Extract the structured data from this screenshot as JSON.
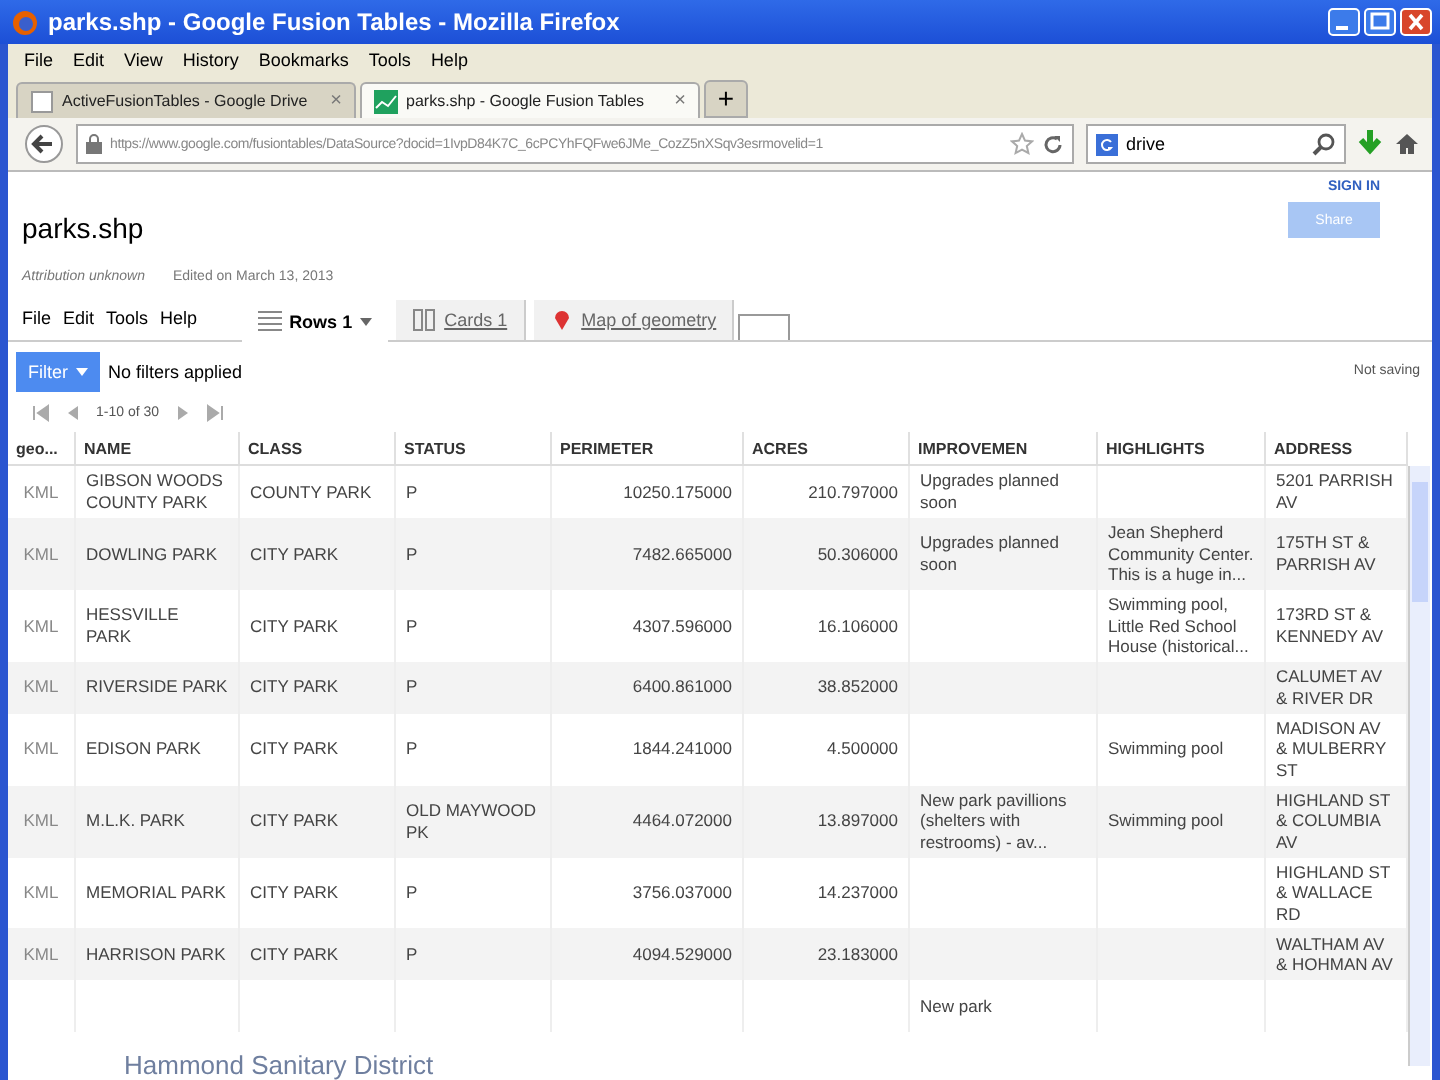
{
  "window": {
    "title": "parks.shp - Google Fusion Tables - Mozilla Firefox"
  },
  "menu": [
    "File",
    "Edit",
    "View",
    "History",
    "Bookmarks",
    "Tools",
    "Help"
  ],
  "browser_tabs": [
    {
      "label": "ActiveFusionTables - Google Drive",
      "selected": false,
      "close": "×"
    },
    {
      "label": "parks.shp - Google Fusion Tables",
      "selected": true,
      "close": "×"
    }
  ],
  "new_tab": "+",
  "address_bar": {
    "value": "https://www.google.com/fusiontables/DataSource?docid=1IvpD84K7C_6cPCYhFQFwe6JMe_CozZ5nXSqv3esrmovelid=1"
  },
  "search_field": {
    "value": "drive"
  },
  "page": {
    "title": "parks.shp",
    "sign_in": "SIGN IN",
    "share": "Share",
    "attribution": "Attribution unknown",
    "edited": "Edited on March 13, 2013"
  },
  "app_menu": [
    "File",
    "Edit",
    "Tools",
    "Help"
  ],
  "view_tabs": [
    {
      "label": "Rows 1",
      "kind": "rows",
      "selected": true
    },
    {
      "label": "Cards 1",
      "kind": "cards",
      "selected": false
    },
    {
      "label": "Map of geometry",
      "kind": "map",
      "selected": false
    }
  ],
  "filter": {
    "button": "Filter",
    "text": "No filters applied",
    "status": "Not saving"
  },
  "pager": "1-10 of 30",
  "table": {
    "columns": [
      "geo...",
      "NAME",
      "CLASS",
      "STATUS",
      "PERIMETER",
      "ACRES",
      "IMPROVEMEN",
      "HIGHLIGHTS",
      "ADDRESS"
    ],
    "rows": [
      [
        "KML",
        "GIBSON WOODS COUNTY PARK",
        "COUNTY PARK",
        "P",
        "10250.175000",
        "210.797000",
        "Upgrades planned soon",
        "",
        "5201 PARRISH AV"
      ],
      [
        "KML",
        "DOWLING PARK",
        "CITY PARK",
        "P",
        "7482.665000",
        "50.306000",
        "Upgrades planned soon",
        "Jean Shepherd Community Center. This is a huge in...",
        "175TH ST & PARRISH AV"
      ],
      [
        "KML",
        "HESSVILLE PARK",
        "CITY PARK",
        "P",
        "4307.596000",
        "16.106000",
        "",
        "Swimming pool, Little Red School House (historical...",
        "173RD ST & KENNEDY AV"
      ],
      [
        "KML",
        "RIVERSIDE PARK",
        "CITY PARK",
        "P",
        "6400.861000",
        "38.852000",
        "",
        "",
        "CALUMET AV & RIVER DR"
      ],
      [
        "KML",
        "EDISON PARK",
        "CITY PARK",
        "P",
        "1844.241000",
        "4.500000",
        "",
        "Swimming pool",
        "MADISON AV & MULBERRY ST"
      ],
      [
        "KML",
        "M.L.K. PARK",
        "CITY PARK",
        "OLD MAYWOOD PK",
        "4464.072000",
        "13.897000",
        "New park pavillions (shelters with restrooms) - av...",
        "Swimming pool",
        "HIGHLAND ST & COLUMBIA AV"
      ],
      [
        "KML",
        "MEMORIAL PARK",
        "CITY PARK",
        "P",
        "3756.037000",
        "14.237000",
        "",
        "",
        "HIGHLAND ST & WALLACE RD"
      ],
      [
        "KML",
        "HARRISON PARK",
        "CITY PARK",
        "P",
        "4094.529000",
        "23.183000",
        "",
        "",
        "WALTHAM AV & HOHMAN AV"
      ],
      [
        "",
        "",
        "",
        "",
        "",
        "",
        "New park",
        "",
        ""
      ]
    ]
  },
  "footer": "Hammond Sanitary District"
}
